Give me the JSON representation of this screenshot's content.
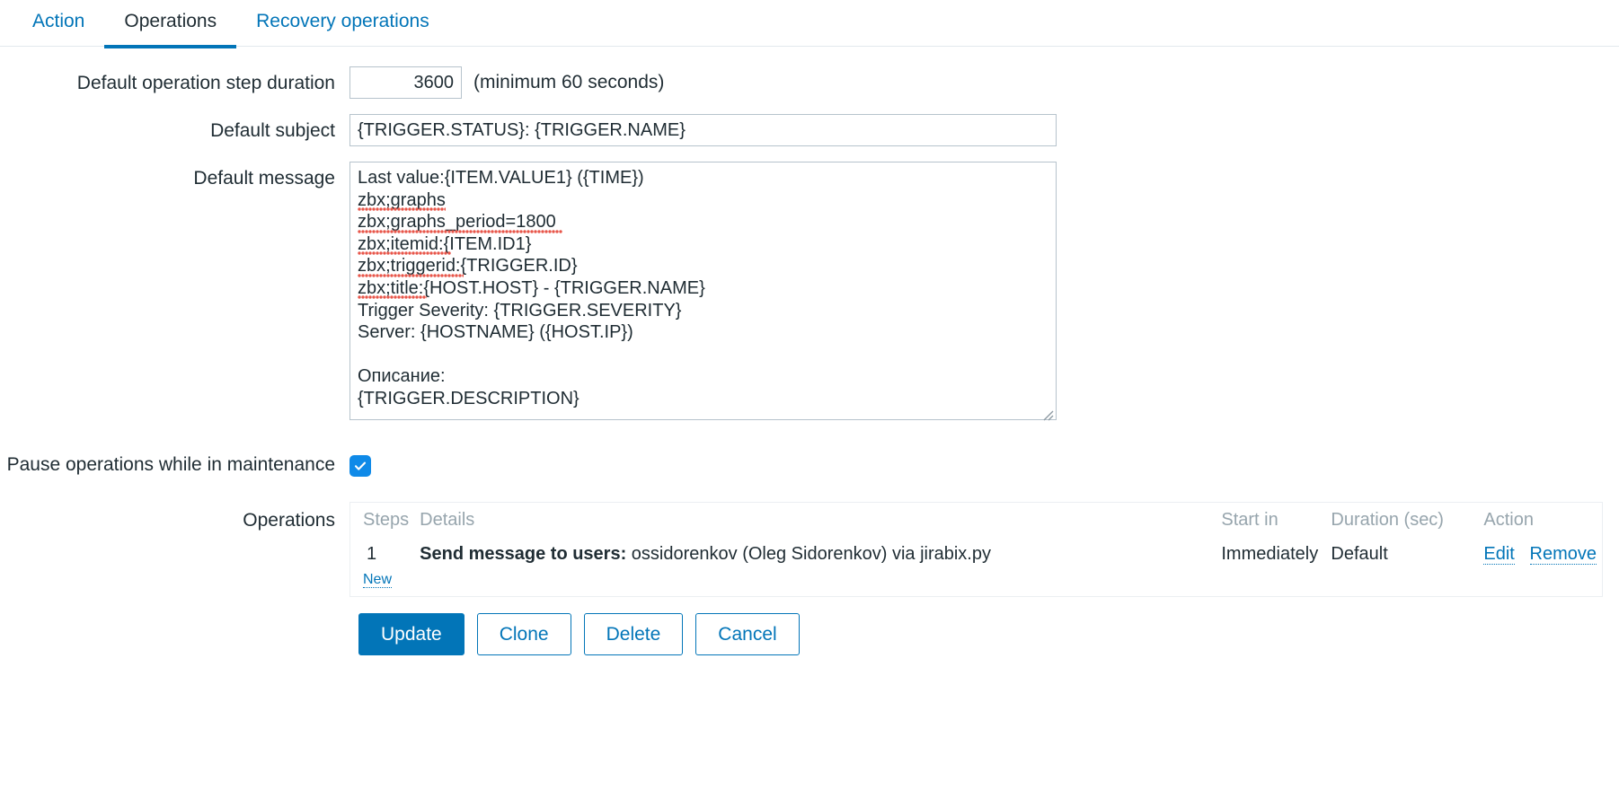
{
  "tabs": [
    {
      "label": "Action",
      "selected": false
    },
    {
      "label": "Operations",
      "selected": true
    },
    {
      "label": "Recovery operations",
      "selected": false
    }
  ],
  "form": {
    "duration": {
      "label": "Default operation step duration",
      "value": "3600",
      "hint": "(minimum 60 seconds)"
    },
    "subject": {
      "label": "Default subject",
      "value": "{TRIGGER.STATUS}: {TRIGGER.NAME}"
    },
    "message": {
      "label": "Default message",
      "value": "Last value:{ITEM.VALUE1} ({TIME})\nzbx;graphs\nzbx;graphs_period=1800\nzbx;itemid:{ITEM.ID1}\nzbx;triggerid:{TRIGGER.ID}\nzbx;title:{HOST.HOST} - {TRIGGER.NAME}\nTrigger Severity: {TRIGGER.SEVERITY}\nServer: {HOSTNAME} ({HOST.IP})\n\nОписание:\n{TRIGGER.DESCRIPTION}"
    },
    "pause": {
      "label": "Pause operations while in maintenance",
      "checked": true
    },
    "operations": {
      "label": "Operations",
      "columns": {
        "steps": "Steps",
        "details": "Details",
        "start_in": "Start in",
        "duration": "Duration (sec)",
        "action": "Action"
      },
      "rows": [
        {
          "step": "1",
          "details_bold": "Send message to users:",
          "details_rest": " ossidorenkov (Oleg Sidorenkov) via jirabix.py",
          "start_in": "Immediately",
          "duration": "Default",
          "edit": "Edit",
          "remove": "Remove"
        }
      ],
      "new_label": "New"
    }
  },
  "buttons": {
    "update": "Update",
    "clone": "Clone",
    "delete": "Delete",
    "cancel": "Cancel"
  },
  "colors": {
    "link": "#0275b8",
    "accent": "#0275b8",
    "checkbox": "#0f8ae8",
    "header_text": "#97a5ad",
    "spellcheck": "#e8564a"
  }
}
